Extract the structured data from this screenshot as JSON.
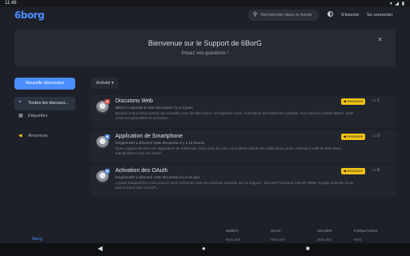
{
  "status": {
    "time": "11:46",
    "icons": "▾ ◢ ▮"
  },
  "header": {
    "logo": "6borg",
    "search_placeholder": "Rechercher dans le forum",
    "signup": "S'inscrire",
    "login": "Se connecter"
  },
  "hero": {
    "title": "Bienvenue sur le Support de 6BorG",
    "subtitle": "Posez vos questions !"
  },
  "actions": {
    "new_discussion": "Nouvelle discussion",
    "sort": "Activité"
  },
  "nav": [
    {
      "label": "Toutes les discussi..."
    },
    {
      "label": "Étiquettes"
    },
    {
      "label": "Annonces"
    }
  ],
  "discussions": [
    {
      "title": "Discutons Web",
      "meta": "6BorG a répondu à cette discussion il y a 2 jours",
      "excerpt": "Bonjour à tous,Nous avons une nouvelle zone de discussion ! Enregistrez-vous, l'inscription est totalement gratuite. Pour tous les clients 6BorG, cette zone est particulière et exclusive...",
      "tag": "Annonces",
      "count": "1"
    },
    {
      "title": "Application de Smartphone",
      "meta": "borgdomeltz a démarré cette discussion il y a 18 heures",
      "excerpt": "Notre support devient une application de téléphone. Dans tous les cas, vous devez activer les notifications push. Android il suffit de faire deux manipulations une fois l'avez...",
      "tag": "Annonces",
      "count": "0"
    },
    {
      "title": "Activation des OAuth",
      "meta": "borgdomeltz a démarré cette discussion il y a un jour",
      "excerpt": "A partir d'aujourd'hui vous pouvez vous connecter avec les services suivants sur ce support : Discord Facebook GitHub Twitter Google LinkedIn Nous avons activé tous ces API...",
      "tag": "Annonces",
      "count": "0"
    }
  ],
  "footer": {
    "logo": "6borg",
    "cols": [
      {
        "head": "WEBPC",
        "sub": "Web Site"
      },
      {
        "head": "SHOP",
        "sub": "Web Site"
      },
      {
        "head": "HELDER",
        "sub": "Web Site"
      },
      {
        "head": "FORMATIONS",
        "sub": "Web"
      }
    ]
  },
  "system_nav": {
    "back": "◀",
    "home": "●",
    "recents": "■"
  }
}
